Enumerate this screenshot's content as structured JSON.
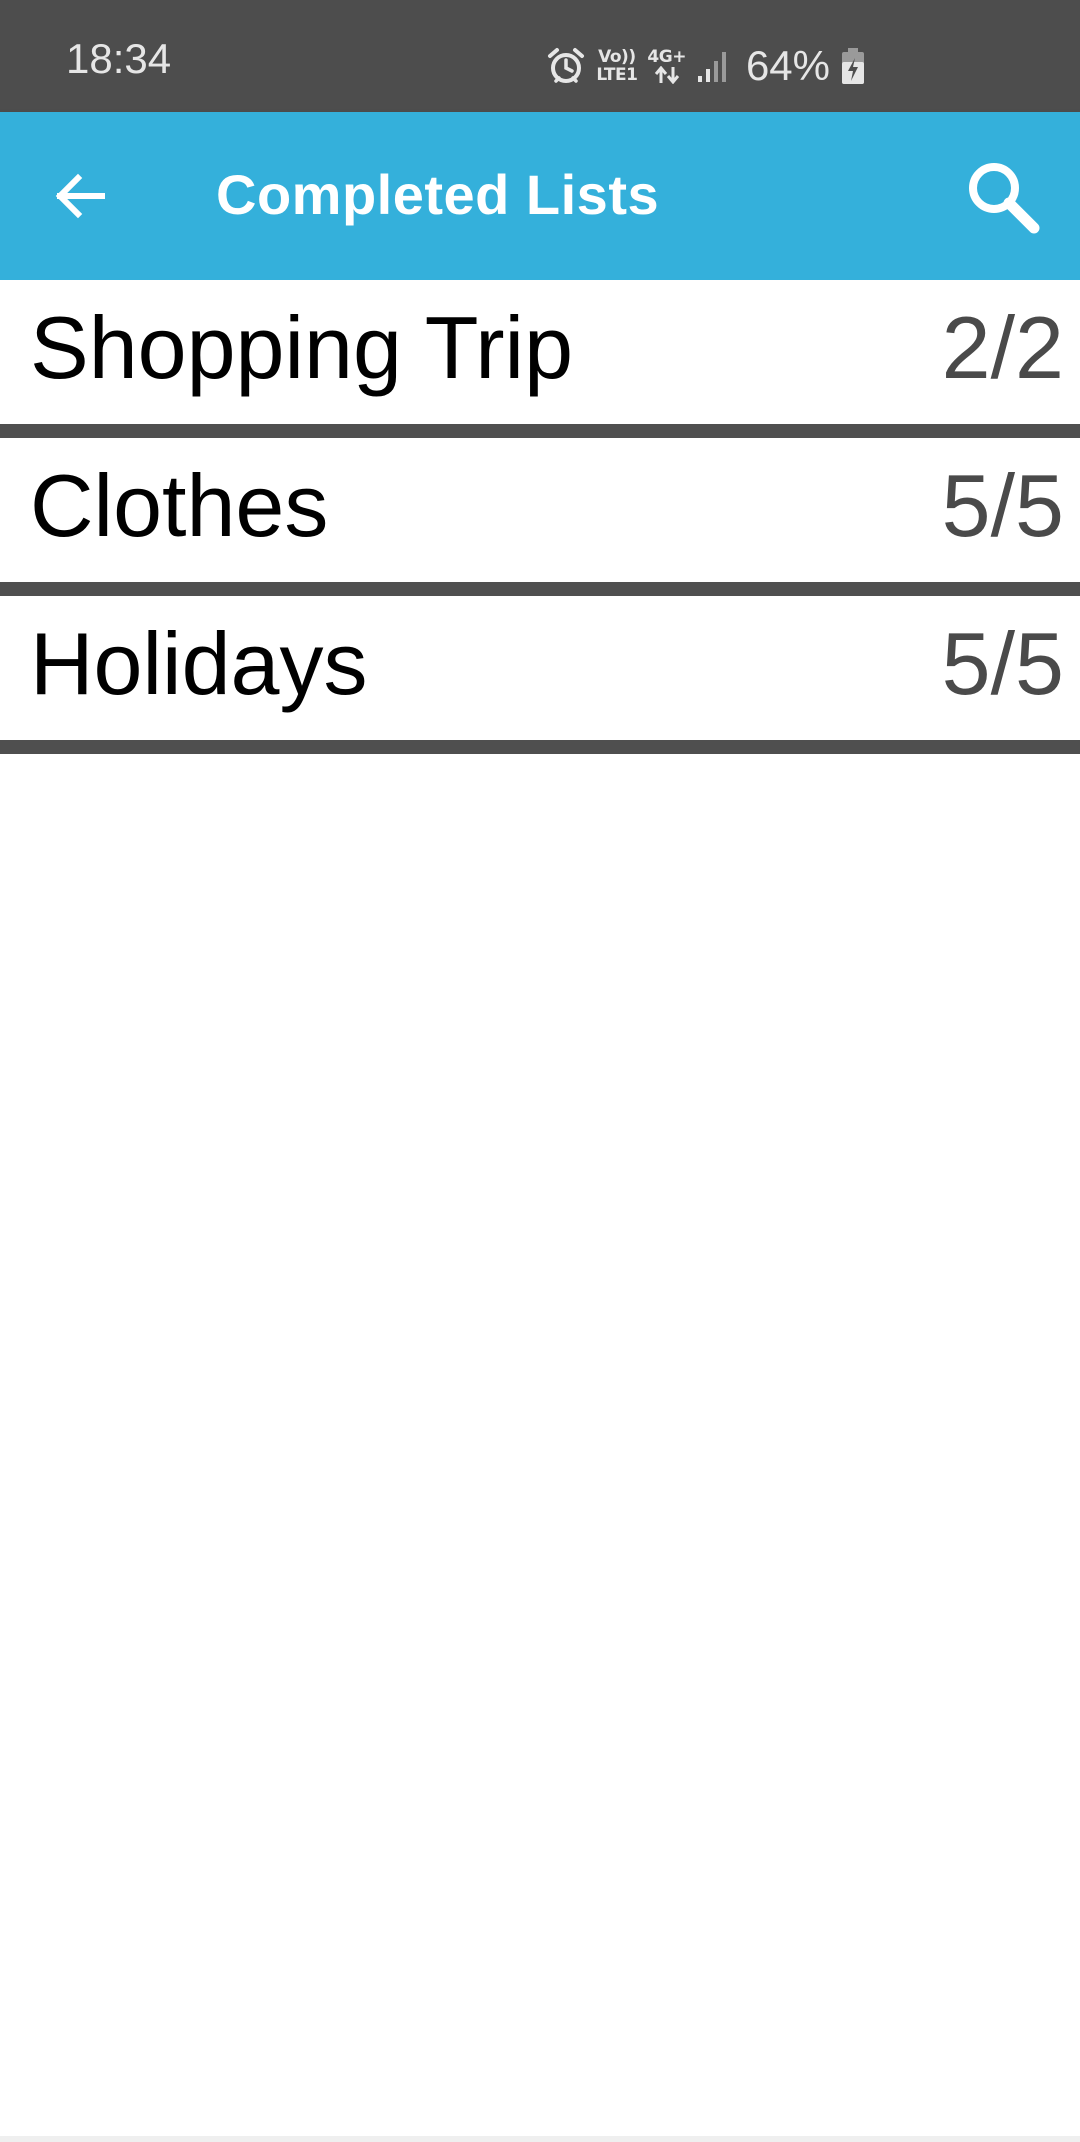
{
  "status_bar": {
    "time": "18:34",
    "volte_top": "Vo))",
    "volte_bottom": "LTE1",
    "network_type": "4G+",
    "battery": "64%",
    "icons": [
      "alarm-icon",
      "volte-icon",
      "data-4g-icon",
      "signal-icon",
      "battery-charging-icon"
    ]
  },
  "app_bar": {
    "title": "Completed Lists",
    "background_color": "#34b0db",
    "back_icon": "arrow-left-icon",
    "search_icon": "search-icon"
  },
  "lists": [
    {
      "name": "Shopping Trip",
      "count": "2/2"
    },
    {
      "name": "Clothes",
      "count": "5/5"
    },
    {
      "name": "Holidays",
      "count": "5/5"
    }
  ],
  "colors": {
    "status_bar": "#4d4d4d",
    "divider": "#4f4f4f",
    "count_text": "#4a4a4a"
  }
}
